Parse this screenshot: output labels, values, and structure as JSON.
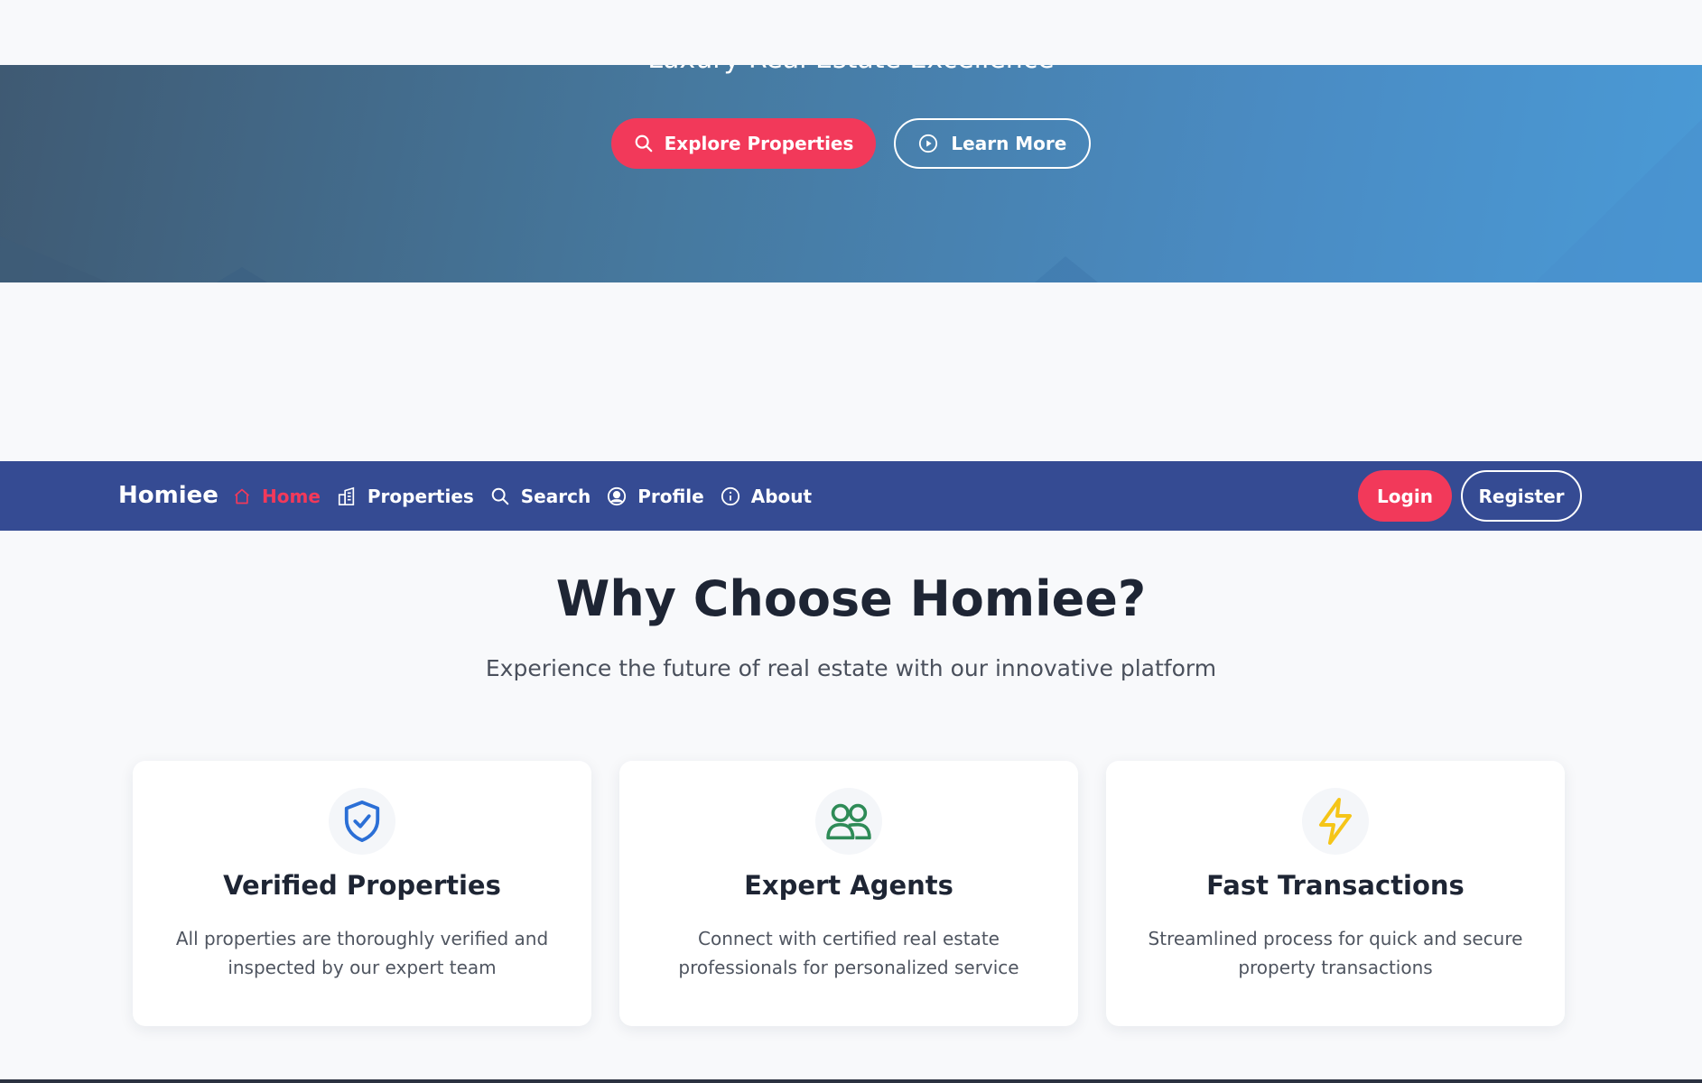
{
  "hero": {
    "tagline": "Luxury Real Estate Excellence",
    "explore_label": "Explore Properties",
    "learn_label": "Learn More"
  },
  "navbar": {
    "brand": "Homiee",
    "links": [
      {
        "label": "Home",
        "icon": "home-icon",
        "active": true
      },
      {
        "label": "Properties",
        "icon": "building-icon"
      },
      {
        "label": "Search",
        "icon": "search-icon"
      },
      {
        "label": "Profile",
        "icon": "user-circle-icon"
      },
      {
        "label": "About",
        "icon": "info-icon"
      }
    ],
    "login_label": "Login",
    "register_label": "Register"
  },
  "why": {
    "title": "Why Choose Homiee?",
    "subtitle": "Experience the future of real estate with our innovative platform"
  },
  "features": [
    {
      "title": "Verified Properties",
      "desc": "All properties are thoroughly verified and inspected by our expert team",
      "icon": "shield-check-icon",
      "color": "#2b6fd6"
    },
    {
      "title": "Expert Agents",
      "desc": "Connect with certified real estate professionals for personalized service",
      "icon": "users-icon",
      "color": "#2e8b57"
    },
    {
      "title": "Fast Transactions",
      "desc": "Streamlined process for quick and secure property transactions",
      "icon": "lightning-icon",
      "color": "#f5c518"
    }
  ],
  "colors": {
    "accent": "#f2395a",
    "navbar": "#354b93",
    "heading": "#1e2534"
  }
}
